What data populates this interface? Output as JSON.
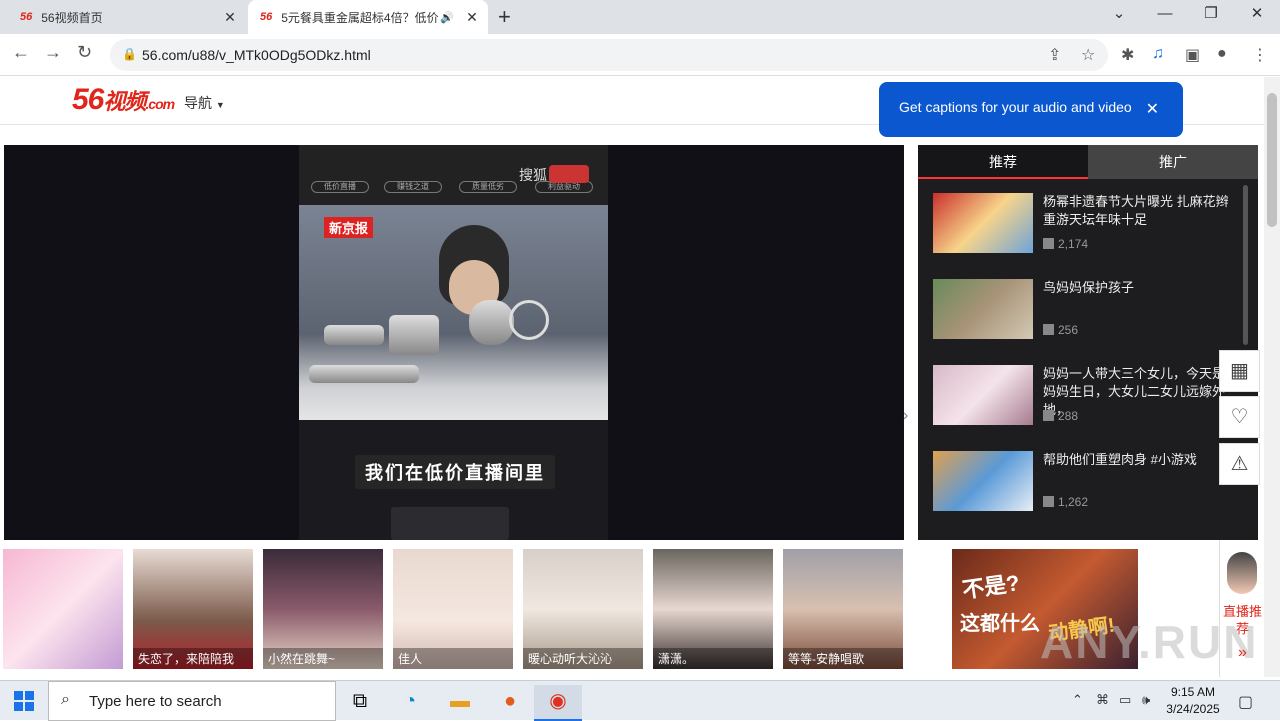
{
  "browser": {
    "tabs": [
      {
        "favicon": "56",
        "title": "56视频首页"
      },
      {
        "favicon": "56",
        "title": "5元餐具重金属超标4倍？低价"
      }
    ],
    "url": "56.com/u88/v_MTk0ODg5ODkz.html"
  },
  "site": {
    "logo_main": "56",
    "logo_text": "视频",
    "logo_sub": ".com",
    "nav_label": "导航",
    "popup_text": "Get captions for your audio and video"
  },
  "player": {
    "top_chips": [
      "低价直播",
      "赚钱之道",
      "质量低劣",
      "利益驱动"
    ],
    "sohu_text": "搜狐",
    "badge": "新京报",
    "subtitle": "我们在低价直播间里"
  },
  "sidebar": {
    "tabs": [
      "推荐",
      "推广"
    ],
    "items": [
      {
        "title": "杨幂非遗春节大片曝光 扎麻花辫重游天坛年味十足",
        "views": "2,174"
      },
      {
        "title": "鸟妈妈保护孩子",
        "views": "256"
      },
      {
        "title": "妈妈一人带大三个女儿，今天是妈妈生日，大女儿二女儿远嫁外地，",
        "views": "288"
      },
      {
        "title": "帮助他们重塑肉身 #小游戏",
        "views": "1,262"
      }
    ]
  },
  "strip": {
    "cards": [
      {
        "caption": ""
      },
      {
        "caption": "失恋了，来陪陪我"
      },
      {
        "caption": "小然在跳舞~"
      },
      {
        "caption": "佳人"
      },
      {
        "caption": "暖心动听大沁沁"
      },
      {
        "caption": "潇潇。"
      },
      {
        "caption": "等等-安静唱歌"
      }
    ],
    "ad_text_1": "不是?",
    "ad_text_2": "这都什么",
    "ad_text_3": "动静啊!",
    "live_label": "直播推荐",
    "watermark": "ANY.RUN"
  },
  "taskbar": {
    "search_placeholder": "Type here to search",
    "time": "9:15 AM",
    "date": "3/24/2025"
  }
}
